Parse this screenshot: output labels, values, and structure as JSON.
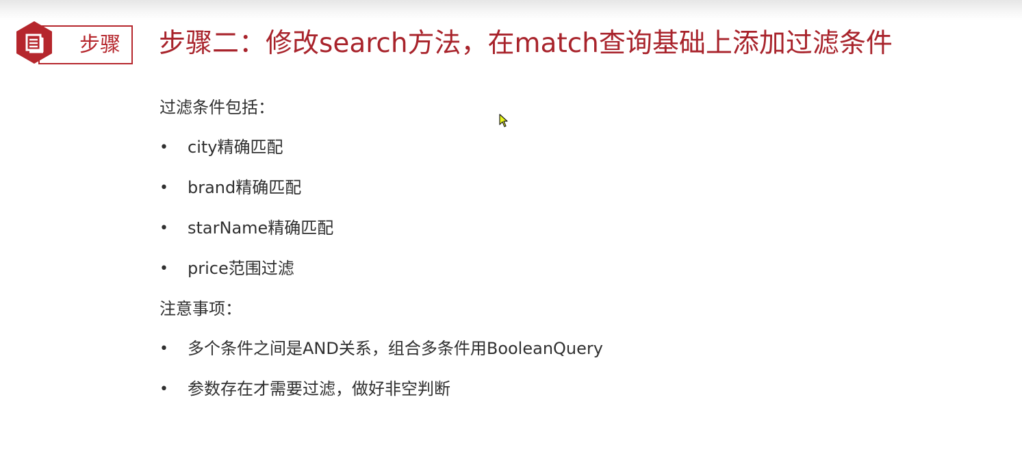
{
  "badge": {
    "icon": "document-icon",
    "label": "步骤"
  },
  "title": "步骤二：修改search方法，在match查询基础上添加过滤条件",
  "sections": [
    {
      "heading": "过滤条件包括：",
      "items": [
        "city精确匹配",
        "brand精确匹配",
        "starName精确匹配",
        "price范围过滤"
      ]
    },
    {
      "heading": "注意事项：",
      "items": [
        "多个条件之间是AND关系，组合多条件用BooleanQuery",
        "参数存在才需要过滤，做好非空判断"
      ]
    }
  ],
  "bullet_glyph": "•",
  "colors": {
    "accent": "#b5262c",
    "title": "#a8232b",
    "body_text": "#2f2f2f",
    "cursor_fill": "#e8f51a"
  }
}
